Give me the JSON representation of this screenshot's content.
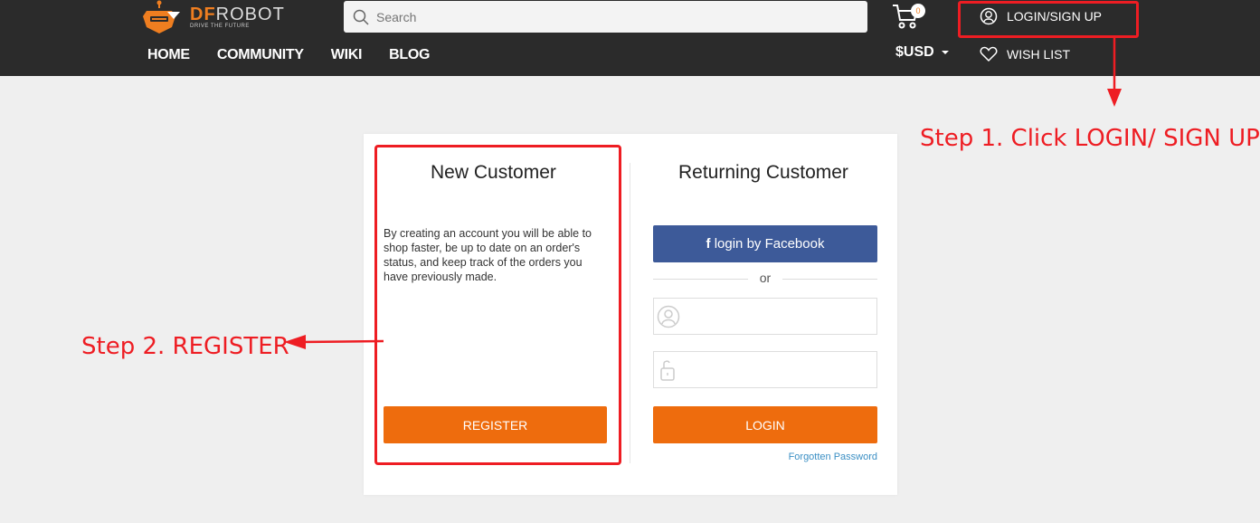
{
  "header": {
    "logo": {
      "brand_orange": "DF",
      "brand_light": "ROBOT",
      "tagline": "DRIVE THE FUTURE"
    },
    "search": {
      "placeholder": "Search",
      "value": ""
    },
    "nav": [
      "HOME",
      "COMMUNITY",
      "WIKI",
      "BLOG"
    ],
    "cart": {
      "count": "0"
    },
    "currency": "$USD",
    "login_label": "LOGIN/SIGN UP",
    "wishlist_label": "WISH LIST"
  },
  "new_customer": {
    "title": "New Customer",
    "description": "By creating an account you will be able to shop faster, be up to date on an order's status, and keep track of the orders you have previously made.",
    "register_label": "REGISTER"
  },
  "returning_customer": {
    "title": "Returning Customer",
    "facebook_label": "login by Facebook",
    "or_label": "or",
    "username_value": "",
    "password_value": "",
    "login_label": "LOGIN",
    "forgot_label": "Forgotten Password"
  },
  "annotations": {
    "step1": "Step 1. Click LOGIN/ SIGN UP",
    "step2": "Step 2. REGISTER"
  },
  "colors": {
    "header_bg": "#2b2b2b",
    "accent_orange": "#ee6c0d",
    "facebook_blue": "#3d5a99",
    "annotation_red": "#ee1d23",
    "link_blue": "#3b8fc4"
  }
}
